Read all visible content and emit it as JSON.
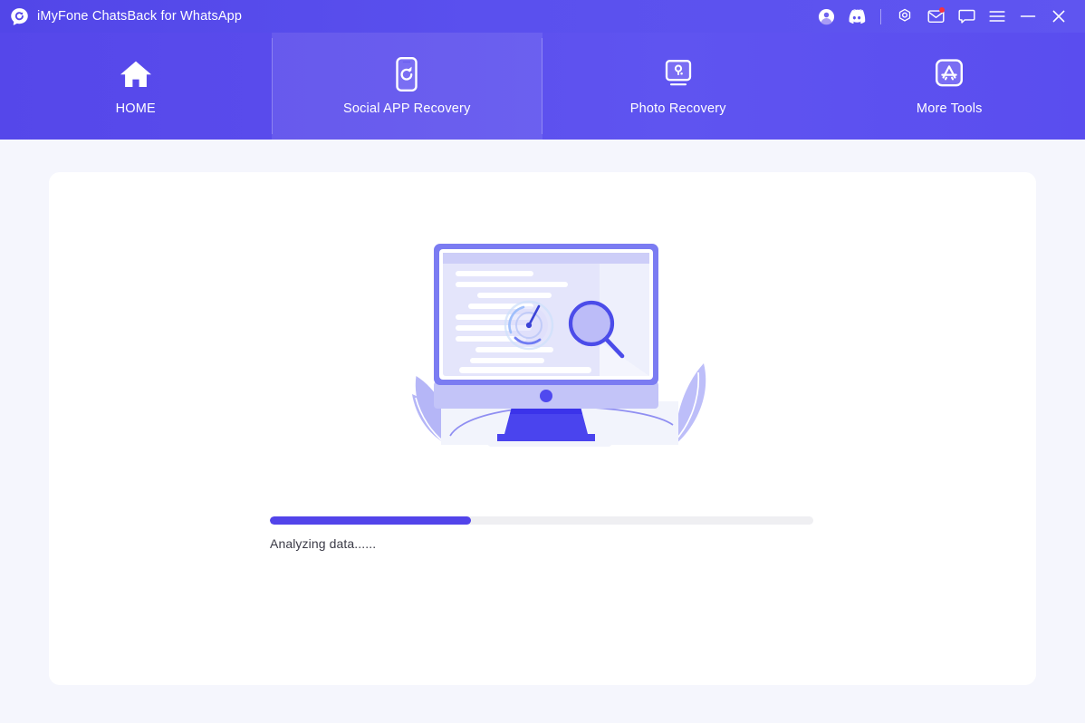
{
  "window": {
    "title": "iMyFone ChatsBack for WhatsApp",
    "logo_icon": "chatsback-logo-icon",
    "brand_color": "#5547ea",
    "accent_color": "#5244ea",
    "notification_dot_color": "#f5333f"
  },
  "titlebar_actions": [
    {
      "name": "account-icon",
      "icon": "user-avatar-icon",
      "tooltip": "Account"
    },
    {
      "name": "discord-icon",
      "icon": "discord-icon",
      "tooltip": "Discord"
    },
    {
      "name": "divider",
      "icon": "divider",
      "tooltip": ""
    },
    {
      "name": "target-icon",
      "icon": "target-icon",
      "tooltip": "Settings"
    },
    {
      "name": "mail-icon",
      "icon": "envelope-icon",
      "tooltip": "Messages",
      "badge": true
    },
    {
      "name": "feedback-icon",
      "icon": "chat-bubble-icon",
      "tooltip": "Feedback"
    },
    {
      "name": "menu-icon",
      "icon": "hamburger-menu-icon",
      "tooltip": "Menu"
    },
    {
      "name": "minimize-icon",
      "icon": "minimize-icon",
      "tooltip": "Minimize"
    },
    {
      "name": "close-icon",
      "icon": "close-icon",
      "tooltip": "Close"
    }
  ],
  "nav": {
    "active_index": 1,
    "tabs": [
      {
        "label": "HOME",
        "icon": "home-icon",
        "active": false
      },
      {
        "label": "Social APP Recovery",
        "icon": "phone-refresh-icon",
        "active": true
      },
      {
        "label": "Photo Recovery",
        "icon": "monitor-photo-icon",
        "active": false
      },
      {
        "label": "More Tools",
        "icon": "app-store-icon",
        "active": false
      }
    ]
  },
  "main": {
    "illustration": "analyzing-monitor-illustration",
    "progress": {
      "percent": 37,
      "percent_text": "37%",
      "status_text": "Analyzing data......"
    }
  }
}
